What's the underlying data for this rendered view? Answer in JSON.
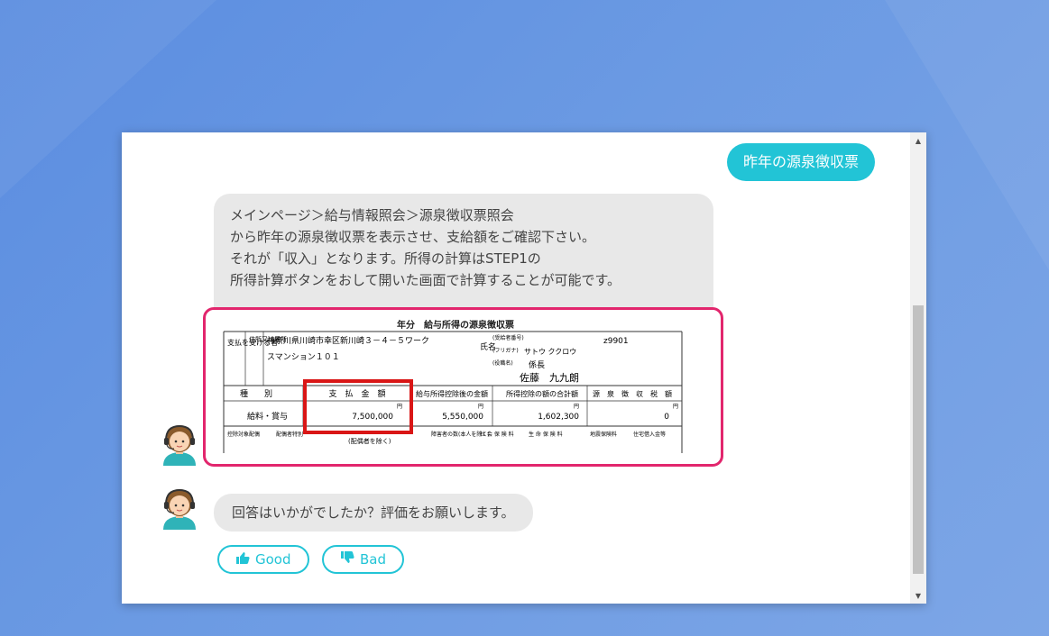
{
  "chat": {
    "user_message": "昨年の源泉徴収票",
    "bot_message": "メインページ＞給与情報照会＞源泉徴収票照会\nから昨年の源泉徴収票を表示させ、支給額をご確認下さい。\nそれが「収入」となります。所得の計算はSTEP1の\n所得計算ボタンをおして開いた画面で計算することが可能です。",
    "bot_question": "回答はいかがでしたか？評価をお願いします。",
    "good_label": "Good",
    "bad_label": "Bad"
  },
  "receipt": {
    "title": "年分　給与所得の源泉徴収票",
    "payer_label": "支払を受ける者",
    "address_label": "住所又は居所",
    "address_line1": "神奈川県川崎市幸区新川崎３－４－５ワーク",
    "address_line2": "スマンション１０１",
    "name_label": "氏名",
    "recipient_number_label": "(受給者番号)",
    "recipient_number": "z9901",
    "furigana_label": "(フリガナ)",
    "furigana": "サトウ ククロウ",
    "position_label": "(役職名)",
    "position": "係長",
    "name": "佐藤　九九朗",
    "col_type": "種　　別",
    "col_payment": "支　払　金　額",
    "col_after_deduction": "給与所得控除後の金額",
    "col_deduction_total": "所得控除の額の合計額",
    "col_tax": "源　泉　徴　収　税　額",
    "row_type": "給料・賞与",
    "unit": "円",
    "payment": "7,500,000",
    "after_deduction": "5,550,000",
    "deduction_total": "1,602,300",
    "tax": "0",
    "footer": [
      "控除対象配偶",
      "配偶者特別",
      "(配偶者を除く)",
      "障害者の数(本人を除く)",
      "社 会 保 険 料",
      "生 命 保 険 料",
      "地震保険料",
      "住宅借入金等"
    ]
  }
}
